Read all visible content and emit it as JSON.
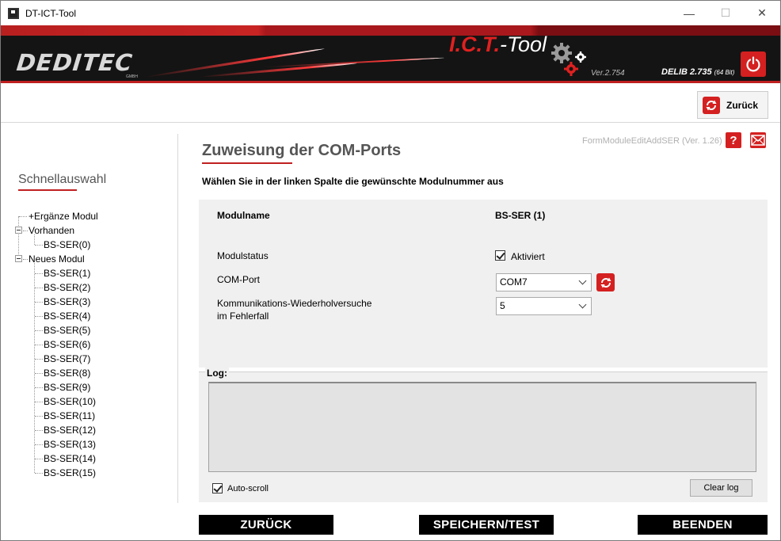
{
  "window": {
    "title": "DT-ICT-Tool",
    "minimize": "—",
    "maximize": "☐",
    "close": "✕"
  },
  "banner": {
    "logo": "DEDITEC",
    "logo_suffix": "GMBH",
    "product_prefix": "I.C.T.",
    "product_suffix": "-Tool",
    "version": "Ver.2.754",
    "delib": "DELIB 2.735",
    "delib_bits": "(64 Bit)",
    "colors": {
      "accent": "#d42020",
      "banner_bg": "#141414"
    }
  },
  "toolbar": {
    "back_label": "Zurück"
  },
  "sidebar": {
    "title": "Schnellauswahl",
    "tree": {
      "add_module": "+Ergänze Modul",
      "existing_group": "Vorhanden",
      "existing_items": [
        "BS-SER(0)"
      ],
      "new_group": "Neues Modul",
      "new_items": [
        "BS-SER(1)",
        "BS-SER(2)",
        "BS-SER(3)",
        "BS-SER(4)",
        "BS-SER(5)",
        "BS-SER(6)",
        "BS-SER(7)",
        "BS-SER(8)",
        "BS-SER(9)",
        "BS-SER(10)",
        "BS-SER(11)",
        "BS-SER(12)",
        "BS-SER(13)",
        "BS-SER(14)",
        "BS-SER(15)"
      ]
    }
  },
  "main": {
    "heading": "Zuweisung der COM-Ports",
    "form_name": "FormModuleEditAddSER (Ver. 1.26)",
    "help_icon": "?",
    "instruction": "Wählen Sie in der linken Spalte die gewünschte Modulnummer aus",
    "fields": {
      "module_name_label": "Modulname",
      "module_name_value": "BS-SER (1)",
      "status_label": "Modulstatus",
      "status_checkbox": "Aktiviert",
      "com_port_label": "COM-Port",
      "com_port_value": "COM7",
      "retry_label_1": "Kommunikations-Wiederholversuche",
      "retry_label_2": "im Fehlerfall",
      "retry_value": "5"
    },
    "log": {
      "label": "Log:",
      "autoscroll": "Auto-scroll",
      "clear": "Clear log"
    }
  },
  "footer": {
    "back": "ZURÜCK",
    "save": "SPEICHERN/TEST",
    "exit": "BEENDEN"
  }
}
